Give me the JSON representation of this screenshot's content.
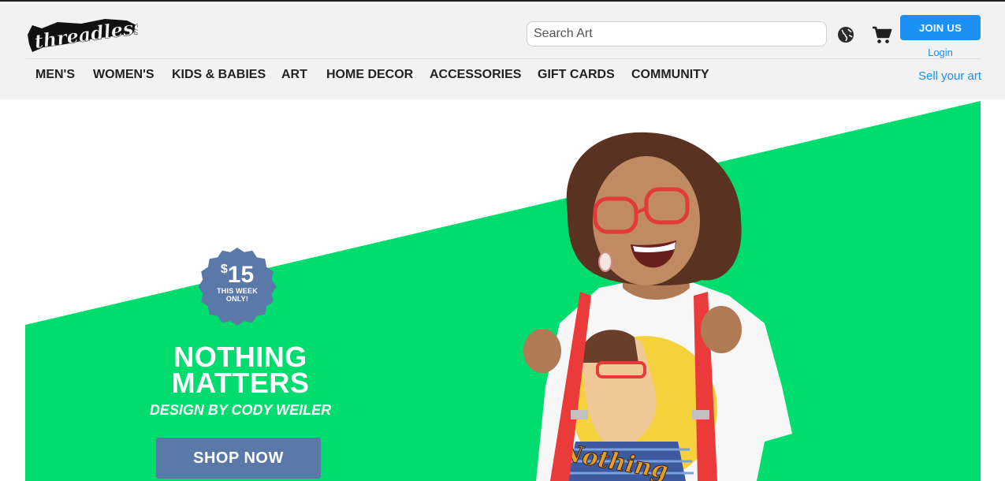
{
  "header": {
    "logo_text": "threadless",
    "search": {
      "placeholder": "Search Art",
      "value": ""
    },
    "join_label": "JOIN US",
    "login_label": "Login",
    "sell_label": "Sell your art"
  },
  "nav": {
    "items": [
      {
        "label": "MEN'S"
      },
      {
        "label": "WOMEN'S"
      },
      {
        "label": "KIDS & BABIES"
      },
      {
        "label": "ART"
      },
      {
        "label": "HOME DECOR"
      },
      {
        "label": "ACCESSORIES"
      },
      {
        "label": "GIFT CARDS"
      },
      {
        "label": "COMMUNITY"
      }
    ]
  },
  "hero": {
    "badge_currency": "$",
    "badge_price": "15",
    "badge_line1": "THIS WEEK",
    "badge_line2": "ONLY!",
    "headline_line1": "NOTHING",
    "headline_line2": "MATTERS",
    "byline": "DESIGN BY CODY WEILER",
    "cta_label": "SHOP NOW",
    "shirt_text": "Nothing"
  },
  "icons": {
    "globe": "globe-icon",
    "cart": "cart-icon",
    "badge": "price-badge-icon"
  },
  "colors": {
    "accent_blue": "#1c90f3",
    "hero_green": "#00dc6e",
    "badge_blue": "#5a78a8",
    "header_bg": "#f2f2f2"
  }
}
